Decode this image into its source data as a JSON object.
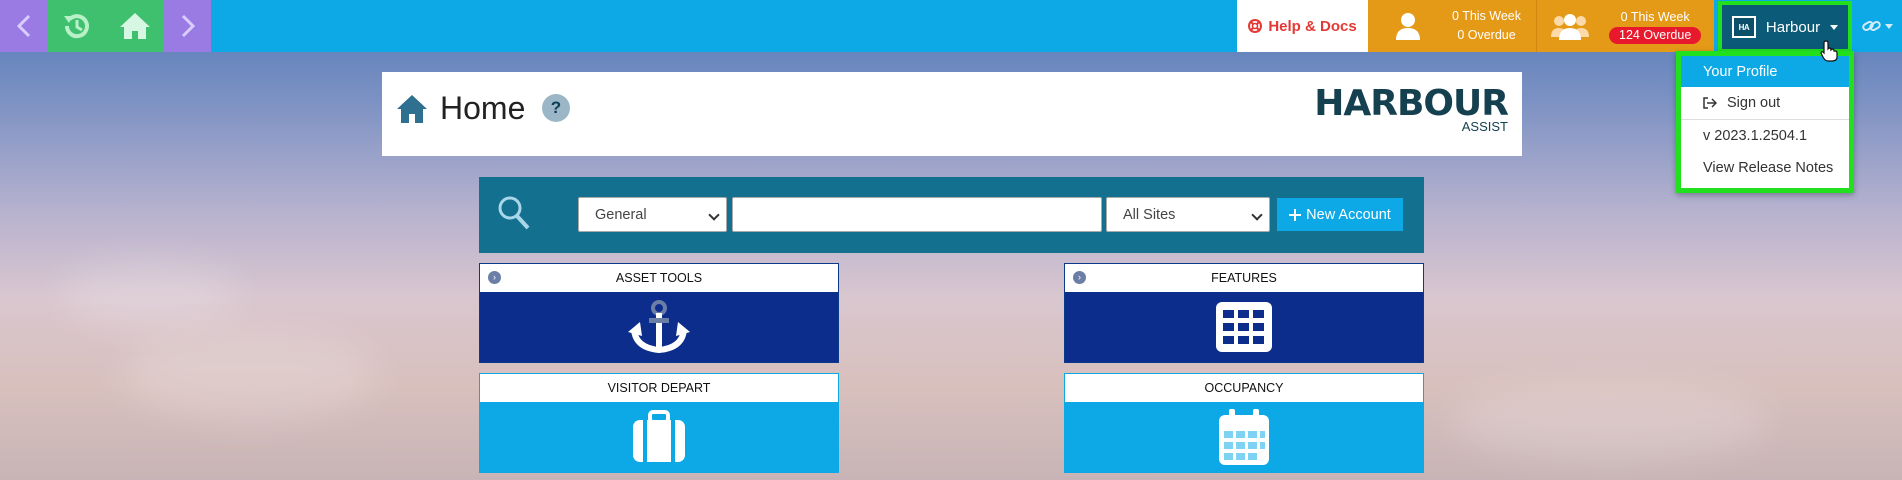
{
  "topbar": {
    "help_docs_label": "Help & Docs",
    "my_tasks": {
      "this_week": "0 This Week",
      "overdue": "0 Overdue"
    },
    "team_tasks": {
      "this_week": "0 This Week",
      "overdue": "124 Overdue"
    },
    "user_badge": "HA",
    "user_name": "Harbour"
  },
  "user_dropdown": {
    "items": [
      {
        "label": "Your Profile"
      },
      {
        "label": "Sign out"
      },
      {
        "label": "v 2023.1.2504.1"
      },
      {
        "label": "View Release Notes"
      }
    ]
  },
  "header": {
    "title": "Home",
    "help_symbol": "?",
    "logo_main": "HARBOUR",
    "logo_sub": "ASSIST"
  },
  "search": {
    "category_value": "General",
    "query_value": "",
    "sites_value": "All Sites",
    "new_account_label": "New Account"
  },
  "tiles": [
    {
      "label": "ASSET TOOLS",
      "icon": "anchor-icon"
    },
    {
      "label": "FEATURES",
      "icon": "grid-icon"
    },
    {
      "label": "VISITOR DEPART",
      "icon": "suitcase-icon"
    },
    {
      "label": "OCCUPANCY",
      "icon": "calendar-icon"
    }
  ],
  "colors": {
    "topbar": "#0ca9e6",
    "nav_purple": "#9a7be3",
    "nav_green": "#3fc06f",
    "tasks_orange": "#e59a17",
    "overdue_red": "#e8192c",
    "highlight_green": "#22e01e",
    "tile_dark": "#0d2d8c",
    "search_panel": "#14708f"
  }
}
